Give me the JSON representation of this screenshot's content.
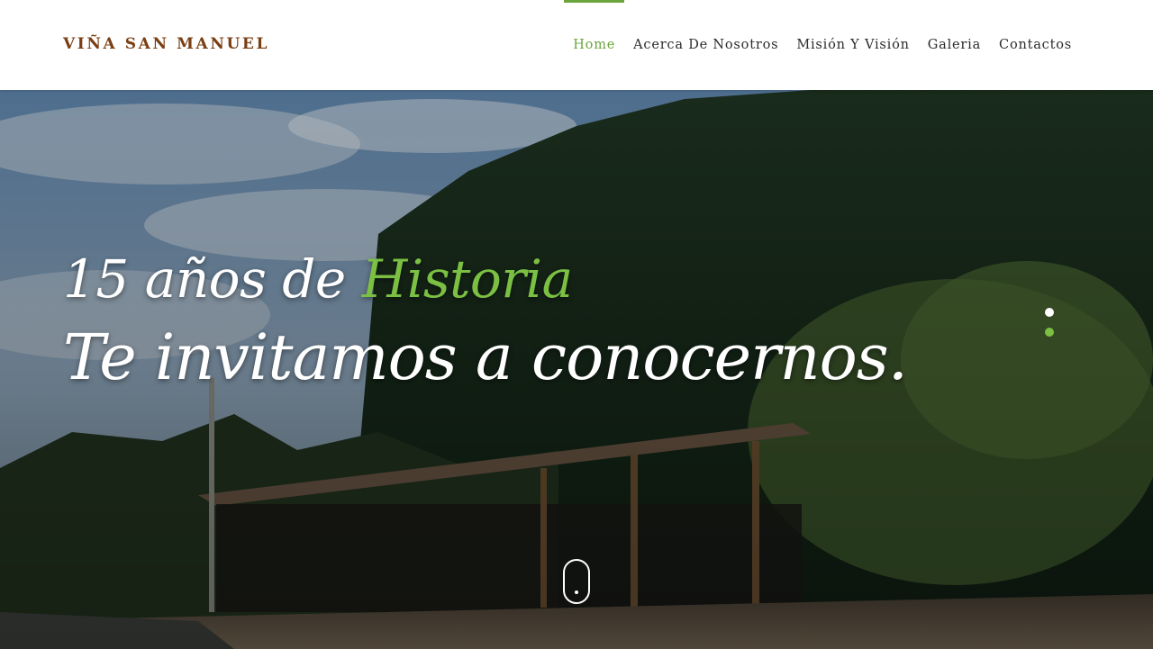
{
  "brand": {
    "name": "VIÑA SAN MANUEL"
  },
  "nav": {
    "items": [
      {
        "label": "Home",
        "active": true
      },
      {
        "label": "Acerca De Nosotros",
        "active": false
      },
      {
        "label": "Misión Y Visión",
        "active": false
      },
      {
        "label": "Galeria",
        "active": false
      },
      {
        "label": "Contactos",
        "active": false
      }
    ]
  },
  "hero": {
    "line1_prefix": "15 años de",
    "line1_accent": "Historia",
    "line2": "Te invitamos a conocernos.",
    "slider": {
      "count": 2,
      "active_index": 1
    },
    "scroll_icon": "mouse-scroll-icon"
  },
  "colors": {
    "brand": "#7a3e12",
    "accent": "#6aa43b",
    "headline_accent": "#7bc043",
    "text": "#2b2b2b"
  }
}
